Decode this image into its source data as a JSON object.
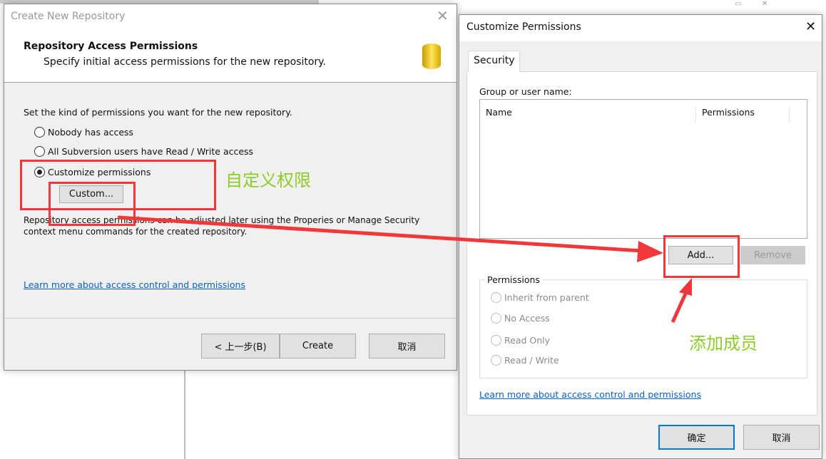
{
  "create_dialog": {
    "title": "Create New Repository",
    "header_title": "Repository Access Permissions",
    "header_subtitle": "Specify initial access permissions for the new repository.",
    "prompt": "Set the kind of permissions you want for the new repository.",
    "options": [
      {
        "label": "Nobody has access",
        "selected": false
      },
      {
        "label": "All Subversion users have Read / Write access",
        "selected": false
      },
      {
        "label": "Customize permissions",
        "selected": true
      }
    ],
    "custom_button": "Custom...",
    "note_line1": "Repository access permissions can be adjusted later using the Properies or Manage Security",
    "note_line2": "context menu commands for the created repository.",
    "learn_more": "Learn more about access control and permissions",
    "back_button": "< 上一步(B)",
    "create_button": "Create",
    "cancel_button": "取消"
  },
  "permissions_dialog": {
    "title": "Customize Permissions",
    "tab": "Security",
    "group_label": "Group or user name:",
    "columns": [
      "Name",
      "Permissions"
    ],
    "add_button": "Add...",
    "remove_button": "Remove",
    "permissions_group": "Permissions",
    "permission_options": [
      "Inherit from parent",
      "No Access",
      "Read Only",
      "Read / Write"
    ],
    "learn_more": "Learn more about access control and permissions",
    "ok_button": "确定",
    "cancel_button": "取消"
  },
  "annotations": {
    "custom_note": "自定义权限",
    "add_note": "添加成员",
    "color": "#f0383a",
    "note_color": "#8ccc2a"
  }
}
